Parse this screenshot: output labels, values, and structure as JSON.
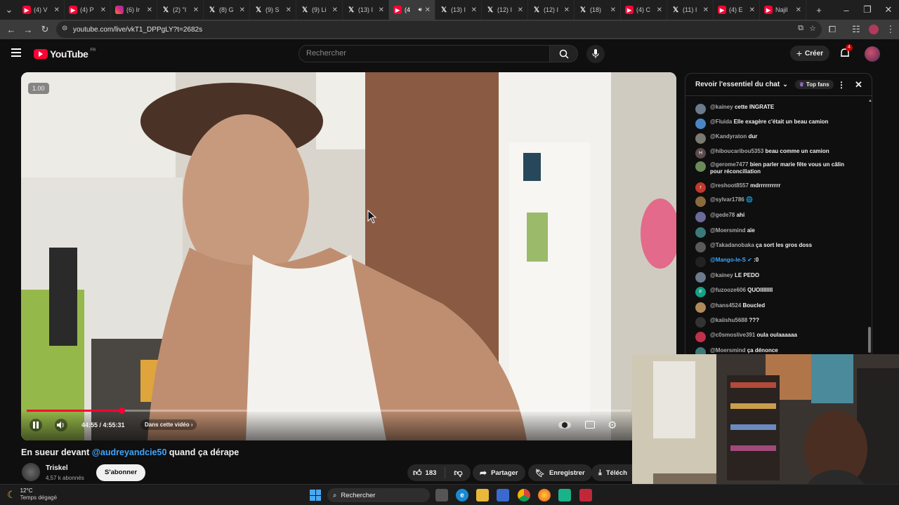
{
  "browser": {
    "tabs": [
      {
        "label": "(4) V",
        "icon": "youtube-icon",
        "active": false
      },
      {
        "label": "(4) P",
        "icon": "youtube-icon",
        "active": false
      },
      {
        "label": "(6) Ir",
        "icon": "instagram-icon",
        "active": false
      },
      {
        "label": "(2) \"I",
        "icon": "x-icon",
        "active": false
      },
      {
        "label": "(8) G",
        "icon": "x-icon",
        "active": false
      },
      {
        "label": "(9) S",
        "icon": "x-icon",
        "active": false
      },
      {
        "label": "(9) Li",
        "icon": "x-icon",
        "active": false
      },
      {
        "label": "(13) I",
        "icon": "x-icon",
        "active": false
      },
      {
        "label": "(4",
        "icon": "youtube-icon",
        "active": true
      },
      {
        "label": "(13) I",
        "icon": "x-icon",
        "active": false
      },
      {
        "label": "(12) I",
        "icon": "x-icon",
        "active": false
      },
      {
        "label": "(12) I",
        "icon": "x-icon",
        "active": false
      },
      {
        "label": "(18)",
        "icon": "x-icon",
        "active": false
      },
      {
        "label": "(4) C",
        "icon": "youtube-icon",
        "active": false
      },
      {
        "label": "(11) I",
        "icon": "x-icon",
        "active": false
      },
      {
        "label": "(4) E",
        "icon": "youtube-icon",
        "active": false
      },
      {
        "label": "Najil",
        "icon": "youtube-icon",
        "active": false
      }
    ],
    "url": "youtube.com/live/vkT1_DPPgLY?t=2682s"
  },
  "youtube": {
    "logo_text": "YouTube",
    "region": "FR",
    "search_placeholder": "Rechercher",
    "create_label": "Créer",
    "notifications_count": "4"
  },
  "player": {
    "speed_badge": "1.00",
    "time": "44:55 / 4:55:31",
    "chapter": "Dans cette vidéo",
    "progress": 0.157
  },
  "video": {
    "title_prefix": "En sueur devant ",
    "title_mention": "@audreyandcie50",
    "title_suffix": " quand ça dérape",
    "channel": "Triskel",
    "subscribers": "4,57 k abonnés",
    "subscribe_label": "S'abonner",
    "likes": "183",
    "share_label": "Partager",
    "save_label": "Enregistrer",
    "download_label": "Téléch"
  },
  "chat": {
    "header_title": "Revoir l'essentiel du chat",
    "top_fans": "Top fans",
    "messages": [
      {
        "author": "@kainey",
        "text": "cette INGRATE",
        "avatar_color": "#6b7a8c",
        "initial": "",
        "verified": false
      },
      {
        "author": "@Fluida",
        "text": "Elle exagère c'était un beau camion",
        "avatar_color": "#4a86c5",
        "initial": "",
        "verified": false
      },
      {
        "author": "@Kandyraton",
        "text": "dur",
        "avatar_color": "#7a7a70",
        "initial": "",
        "verified": false
      },
      {
        "author": "@hiboucaribou5353",
        "text": "beau comme un camion",
        "avatar_color": "#5d4a4a",
        "initial": "H",
        "verified": false
      },
      {
        "author": "@gerome7477",
        "text": "bien parler marie fête vous un câlin pour réconciliation",
        "avatar_color": "#6a8a5a",
        "initial": "",
        "verified": false
      },
      {
        "author": "@reshoot8557",
        "text": "mdrrrrrrrrrr",
        "avatar_color": "#c0392b",
        "initial": "r",
        "verified": false
      },
      {
        "author": "@sylvar1786",
        "text": "🌐",
        "avatar_color": "#8a6b3c",
        "initial": "",
        "verified": false
      },
      {
        "author": "@gede78",
        "text": "ahi",
        "avatar_color": "#6b6b9a",
        "initial": "",
        "verified": false
      },
      {
        "author": "@Moersmind",
        "text": "aïe",
        "avatar_color": "#3c7a7a",
        "initial": "",
        "verified": false
      },
      {
        "author": "@Takadanobaka",
        "text": "ça sort les gros doss",
        "avatar_color": "#5a5a5a",
        "initial": "",
        "verified": false
      },
      {
        "author": "@Mango-le-S",
        "text": ":0",
        "avatar_color": "#222",
        "initial": "",
        "verified": true
      },
      {
        "author": "@kainey",
        "text": "LE PEDO",
        "avatar_color": "#6b7a8c",
        "initial": "",
        "verified": false
      },
      {
        "author": "@fuzooze606",
        "text": "QUOIIIIIIII",
        "avatar_color": "#16a085",
        "initial": "F",
        "verified": false
      },
      {
        "author": "@hans4524",
        "text": "Boucled",
        "avatar_color": "#b08a5a",
        "initial": "",
        "verified": false
      },
      {
        "author": "@kaiishu5688",
        "text": "???",
        "avatar_color": "#333",
        "initial": "",
        "verified": false
      },
      {
        "author": "@c0smoslive391",
        "text": "oula oulaaaaaa",
        "avatar_color": "#c0304a",
        "initial": "",
        "verified": false
      },
      {
        "author": "@Moersmind",
        "text": "ça dénonce",
        "avatar_color": "#3c7a7a",
        "initial": "",
        "verified": false
      }
    ]
  },
  "taskbar": {
    "temperature": "12°C",
    "weather": "Temps dégagé",
    "search_label": "Rechercher"
  }
}
